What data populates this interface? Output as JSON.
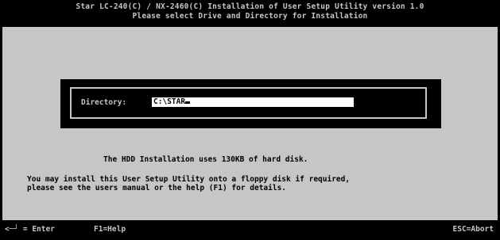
{
  "header": {
    "title": "Star LC-240(C) / NX-2460(C) Installation of User Setup Utility version 1.0",
    "subtitle": "Please select Drive and Directory for Installation"
  },
  "directory": {
    "label": "Directory:",
    "value": "C:\\STAR"
  },
  "messages": {
    "hdd": "The HDD Installation uses 130KB of hard disk.",
    "line1": "You may install this User Setup Utility onto a floppy disk if required,",
    "line2": "please see the users manual or the help (F1) for details."
  },
  "status_bar": {
    "enter": "<─┘ = Enter",
    "help": "F1=Help",
    "abort": "ESC=Abort"
  },
  "colors": {
    "background": "#c6c6c6",
    "bars": "#000000",
    "field": "#ffffff"
  }
}
